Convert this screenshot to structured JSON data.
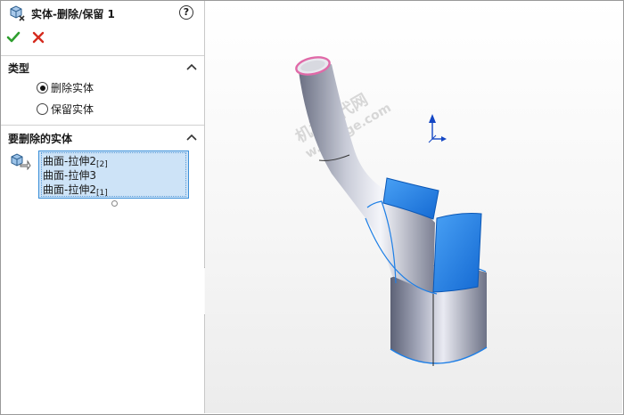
{
  "property_manager": {
    "title": "实体-删除/保留 1",
    "help_symbol": "?",
    "section_type": {
      "header": "类型",
      "options": [
        {
          "label": "删除实体",
          "selected": true
        },
        {
          "label": "保留实体",
          "selected": false
        }
      ]
    },
    "section_bodies": {
      "header": "要删除的实体",
      "items": [
        {
          "main": "曲面-拉伸2",
          "sub": "[2]"
        },
        {
          "main": "曲面-拉伸3",
          "sub": ""
        },
        {
          "main": "曲面-拉伸2",
          "sub": "[1]"
        }
      ]
    }
  },
  "watermark": {
    "line1": "机械时代网",
    "line2": "w.jixinge.com"
  },
  "colors": {
    "selection_blue": "#1e7fe6",
    "edge_pink": "#e06aa8",
    "ok_green": "#2e9e2e",
    "cancel_red": "#d52b1e"
  }
}
